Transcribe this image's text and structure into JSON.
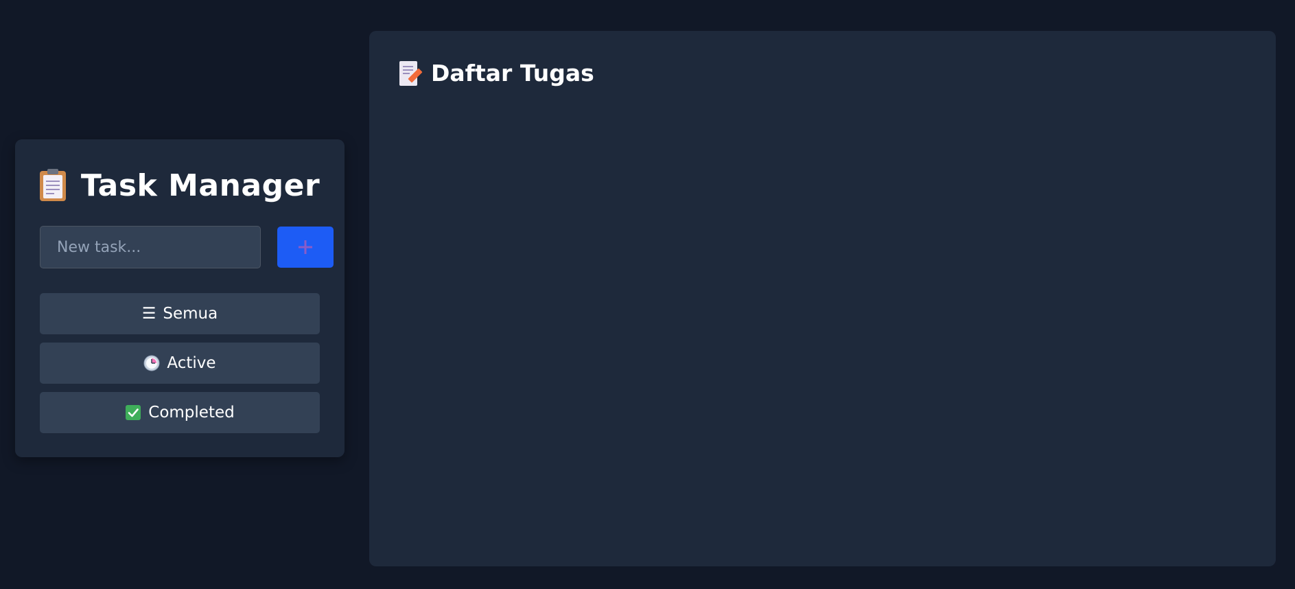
{
  "sidebar": {
    "title": "Task Manager",
    "title_icon": "clipboard-icon",
    "new_task_input": {
      "placeholder": "New task...",
      "value": ""
    },
    "add_button": {
      "icon": "plus-icon",
      "label": "+"
    },
    "filters": [
      {
        "icon": "☰",
        "icon_name": "list-icon",
        "label": "Semua"
      },
      {
        "icon": "🕒",
        "icon_name": "clock-icon",
        "label": "Active"
      },
      {
        "icon": "✅",
        "icon_name": "check-icon",
        "label": "Completed"
      }
    ]
  },
  "main": {
    "title": "Daftar Tugas",
    "title_icon": "memo-icon",
    "tasks": []
  },
  "colors": {
    "background": "#111827",
    "card": "#1e293b",
    "input": "#334155",
    "accent": "#1d5cf5",
    "plus": "#8a5cc8",
    "check_green": "#3fae5a"
  }
}
